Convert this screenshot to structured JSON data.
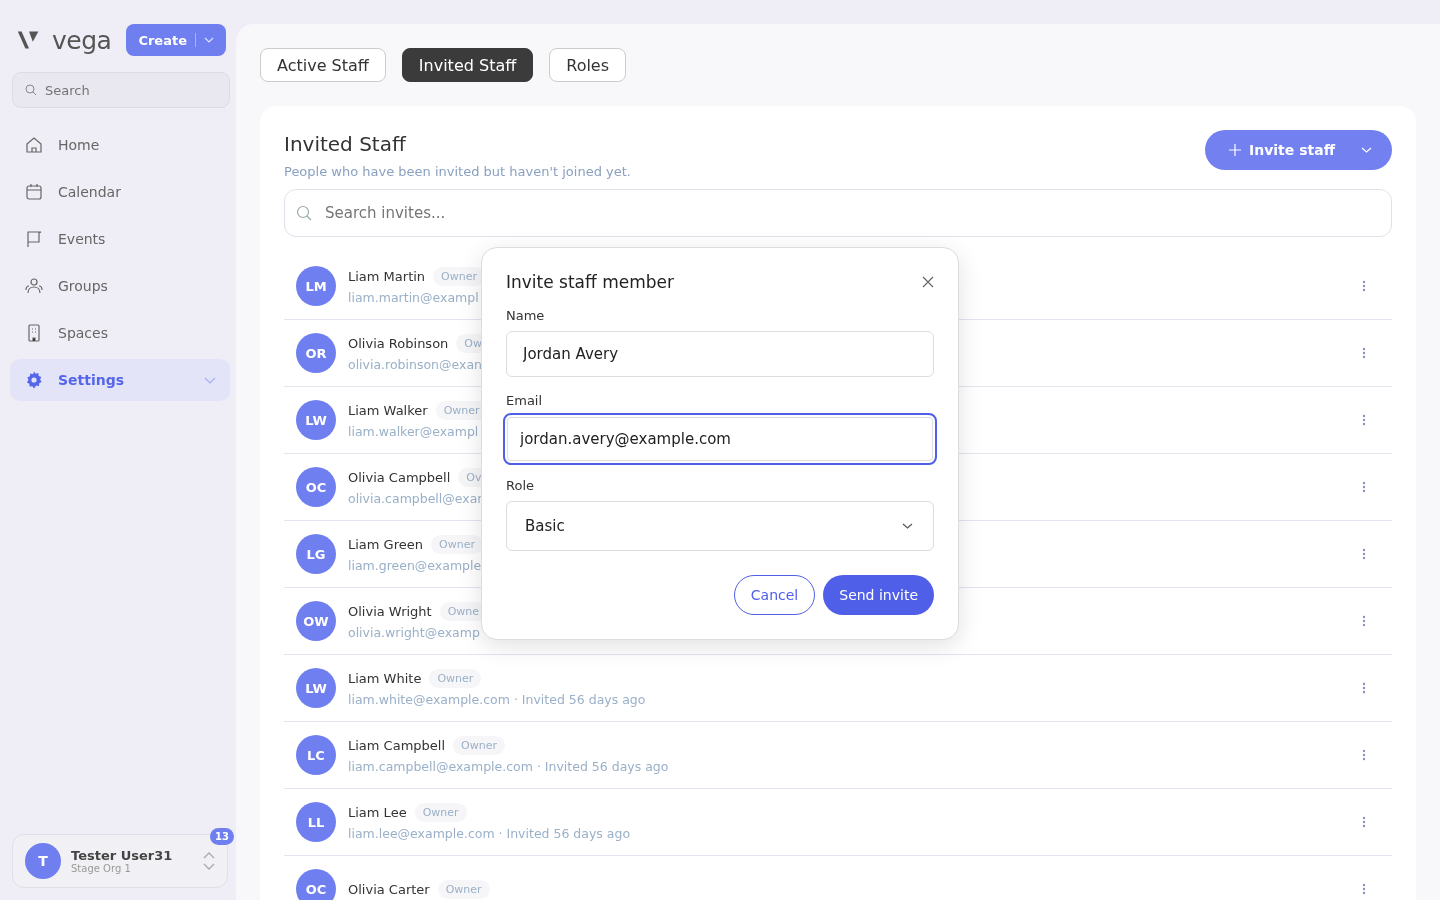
{
  "brand": {
    "name": "vega",
    "create_button": "Create"
  },
  "sidebar": {
    "search_placeholder": "Search",
    "items": [
      {
        "label": "Home",
        "selected": false,
        "expandable": false
      },
      {
        "label": "Calendar",
        "selected": false,
        "expandable": false
      },
      {
        "label": "Events",
        "selected": false,
        "expandable": false
      },
      {
        "label": "Groups",
        "selected": false,
        "expandable": false
      },
      {
        "label": "Spaces",
        "selected": false,
        "expandable": false
      },
      {
        "label": "Settings",
        "selected": true,
        "expandable": true
      }
    ],
    "user": {
      "initial": "T",
      "name": "Tester User31",
      "org": "Stage Org 1",
      "badge": "13"
    }
  },
  "tabs": [
    {
      "label": "Active Staff",
      "selected": false
    },
    {
      "label": "Invited Staff",
      "selected": true
    },
    {
      "label": "Roles",
      "selected": false
    }
  ],
  "panel": {
    "title": "Invited Staff",
    "subtitle": "People who have been invited but haven't joined yet.",
    "invite_button": "Invite staff",
    "search_placeholder": "Search invites..."
  },
  "invites": [
    {
      "initials": "LM",
      "name": "Liam Martin",
      "role": "Owner",
      "detail": "liam.martin@exampl"
    },
    {
      "initials": "OR",
      "name": "Olivia Robinson",
      "role": "Ow",
      "detail": "olivia.robinson@exan"
    },
    {
      "initials": "LW",
      "name": "Liam Walker",
      "role": "Owner",
      "detail": "liam.walker@exampl"
    },
    {
      "initials": "OC",
      "name": "Olivia Campbell",
      "role": "Ov",
      "detail": "olivia.campbell@exar"
    },
    {
      "initials": "LG",
      "name": "Liam Green",
      "role": "Owner",
      "detail": "liam.green@example"
    },
    {
      "initials": "OW",
      "name": "Olivia Wright",
      "role": "Owne",
      "detail": "olivia.wright@examp"
    },
    {
      "initials": "LW",
      "name": "Liam White",
      "role": "Owner",
      "detail": "liam.white@example.com · Invited 56 days ago"
    },
    {
      "initials": "LC",
      "name": "Liam Campbell",
      "role": "Owner",
      "detail": "liam.campbell@example.com · Invited 56 days ago"
    },
    {
      "initials": "LL",
      "name": "Liam Lee",
      "role": "Owner",
      "detail": "liam.lee@example.com · Invited 56 days ago"
    },
    {
      "initials": "OC",
      "name": "Olivia Carter",
      "role": "Owner"
    }
  ],
  "dialog": {
    "title": "Invite staff member",
    "fields": [
      {
        "label": "Name",
        "value": "Jordan Avery",
        "kind": "text",
        "focused": false
      },
      {
        "label": "Email",
        "value": "jordan.avery@example.com",
        "kind": "text",
        "focused": true
      },
      {
        "label": "Role",
        "value": "Basic",
        "kind": "select",
        "focused": false
      }
    ],
    "cancel": "Cancel",
    "submit": "Send invite"
  }
}
